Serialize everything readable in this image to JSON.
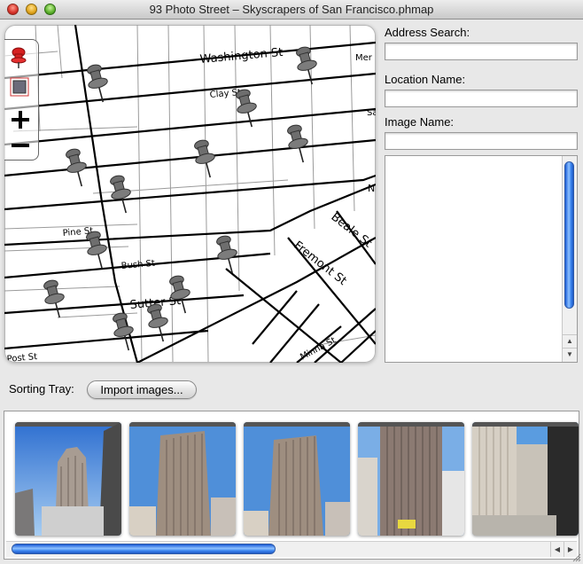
{
  "window": {
    "title": "93 Photo Street – Skyscrapers of San Francisco.phmap"
  },
  "map": {
    "street_labels": [
      "Washington St",
      "Clay St",
      "Pine St",
      "Bush St",
      "Sutter St",
      "Post St",
      "Beale St",
      "Fremont St",
      "Minna St",
      "Mer",
      "Sa",
      "N"
    ],
    "controls": [
      "add-pin",
      "photo-frame",
      "zoom-in",
      "zoom-out"
    ],
    "zoom_in_symbol": "+",
    "zoom_out_symbol": "−",
    "pin_count": 15,
    "active_pin_color": "#d62020",
    "pin_color": "#6e6e6e"
  },
  "fields": {
    "address_label": "Address Search:",
    "address_value": "",
    "location_label": "Location Name:",
    "location_value": "",
    "image_label": "Image Name:",
    "image_value": ""
  },
  "tray": {
    "label": "Sorting Tray:",
    "import_button": "Import images...",
    "thumbnails": [
      {
        "name": "photo-1",
        "subject": "skyscraper with tiered top"
      },
      {
        "name": "photo-2",
        "subject": "tall grid-facade tower"
      },
      {
        "name": "photo-3",
        "subject": "tall grid-facade tower"
      },
      {
        "name": "photo-4",
        "subject": "street view with tall tower"
      },
      {
        "name": "photo-5",
        "subject": "tower with neighboring buildings"
      }
    ]
  },
  "scroll_arrows": {
    "up": "▲",
    "down": "▼",
    "left": "◀",
    "right": "▶"
  },
  "colors": {
    "scroll_thumb": "#3d86f0",
    "window_bg": "#e8e8e8"
  }
}
